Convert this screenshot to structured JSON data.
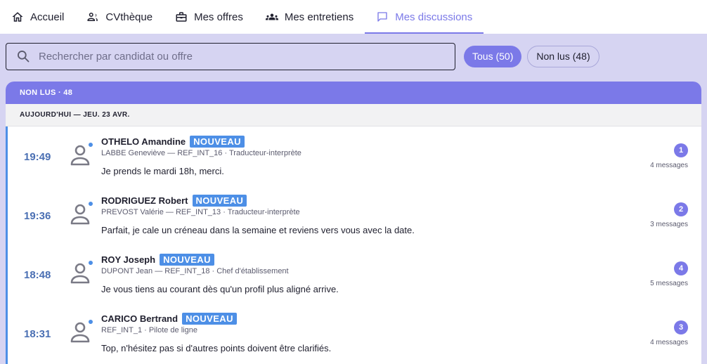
{
  "nav": {
    "items": [
      {
        "label": "Accueil",
        "icon": "home-icon",
        "active": false
      },
      {
        "label": "CVthèque",
        "icon": "people-icon",
        "active": false
      },
      {
        "label": "Mes offres",
        "icon": "briefcase-icon",
        "active": false
      },
      {
        "label": "Mes entretiens",
        "icon": "group-icon",
        "active": false
      },
      {
        "label": "Mes discussions",
        "icon": "chat-icon",
        "active": true
      }
    ]
  },
  "search": {
    "placeholder": "Rechercher par candidat ou offre",
    "value": ""
  },
  "filters": {
    "all_label": "Tous (50)",
    "unread_label": "Non lus (48)"
  },
  "panel": {
    "header": "NON LUS · 48",
    "day_header": "AUJOURD'HUI — JEU. 23 AVR."
  },
  "conversations": [
    {
      "time": "19:49",
      "name": "OTHELO Amandine",
      "badge": "NOUVEAU",
      "sub": "LABBE Geneviève — REF_INT_16 · Traducteur-interprète",
      "message": "Je prends le mardi 18h, merci.",
      "unread_count": "1",
      "message_count": "4 messages"
    },
    {
      "time": "19:36",
      "name": "RODRIGUEZ Robert",
      "badge": "NOUVEAU",
      "sub": "PREVOST Valérie — REF_INT_13 · Traducteur-interprète",
      "message": "Parfait, je cale un créneau dans la semaine et reviens vers vous avec la date.",
      "unread_count": "2",
      "message_count": "3 messages"
    },
    {
      "time": "18:48",
      "name": "ROY Joseph",
      "badge": "NOUVEAU",
      "sub": "DUPONT Jean — REF_INT_18 · Chef d'établissement",
      "message": "Je vous tiens au courant dès qu'un profil plus aligné arrive.",
      "unread_count": "4",
      "message_count": "5 messages"
    },
    {
      "time": "18:31",
      "name": "CARICO Bertrand",
      "badge": "NOUVEAU",
      "sub": "REF_INT_1 · Pilote de ligne",
      "message": "Top, n'hésitez pas si d'autres points doivent être clarifiés.",
      "unread_count": "3",
      "message_count": "4 messages"
    }
  ],
  "colors": {
    "accent": "#7b79e8",
    "unread_blue": "#4d8fe6",
    "page_bg": "#d6d4f2"
  }
}
